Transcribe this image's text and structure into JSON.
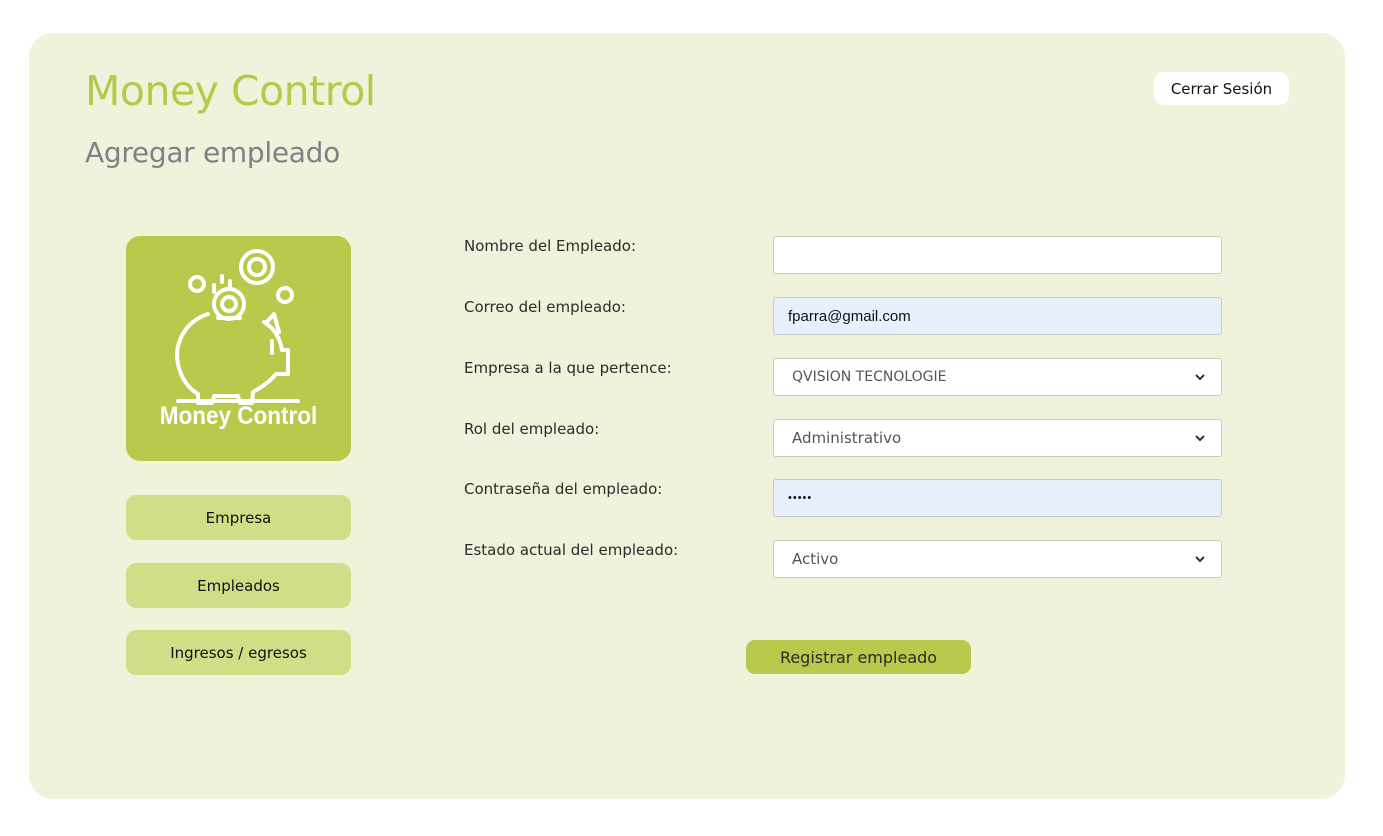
{
  "app": {
    "title": "Money Control",
    "logo_text": "Money Control"
  },
  "page": {
    "title": "Agregar empleado"
  },
  "header": {
    "logout_label": "Cerrar Sesión"
  },
  "nav": {
    "items": [
      {
        "label": "Empresa"
      },
      {
        "label": "Empleados"
      },
      {
        "label": "Ingresos / egresos"
      }
    ]
  },
  "form": {
    "name": {
      "label": "Nombre del Empleado:",
      "value": ""
    },
    "email": {
      "label": "Correo del empleado:",
      "value": "fparra@gmail.com"
    },
    "company": {
      "label": "Empresa a la que pertence:",
      "value": "QVISION TECNOLOGIE"
    },
    "role": {
      "label": "Rol del empleado:",
      "value": "Administrativo"
    },
    "password": {
      "label": "Contraseña del empleado:",
      "value": "•••••"
    },
    "status": {
      "label": "Estado actual del empleado:",
      "value": "Activo"
    },
    "submit_label": "Registrar empleado"
  },
  "icons": {
    "logo": "piggy-bank-icon",
    "dropdown": "chevron-down-icon"
  },
  "colors": {
    "accent": "#b9c94b",
    "background": "#eff3dc",
    "nav_button": "#d2dd88",
    "subtitle": "#7d8285",
    "autofill": "#e8f0fe"
  }
}
